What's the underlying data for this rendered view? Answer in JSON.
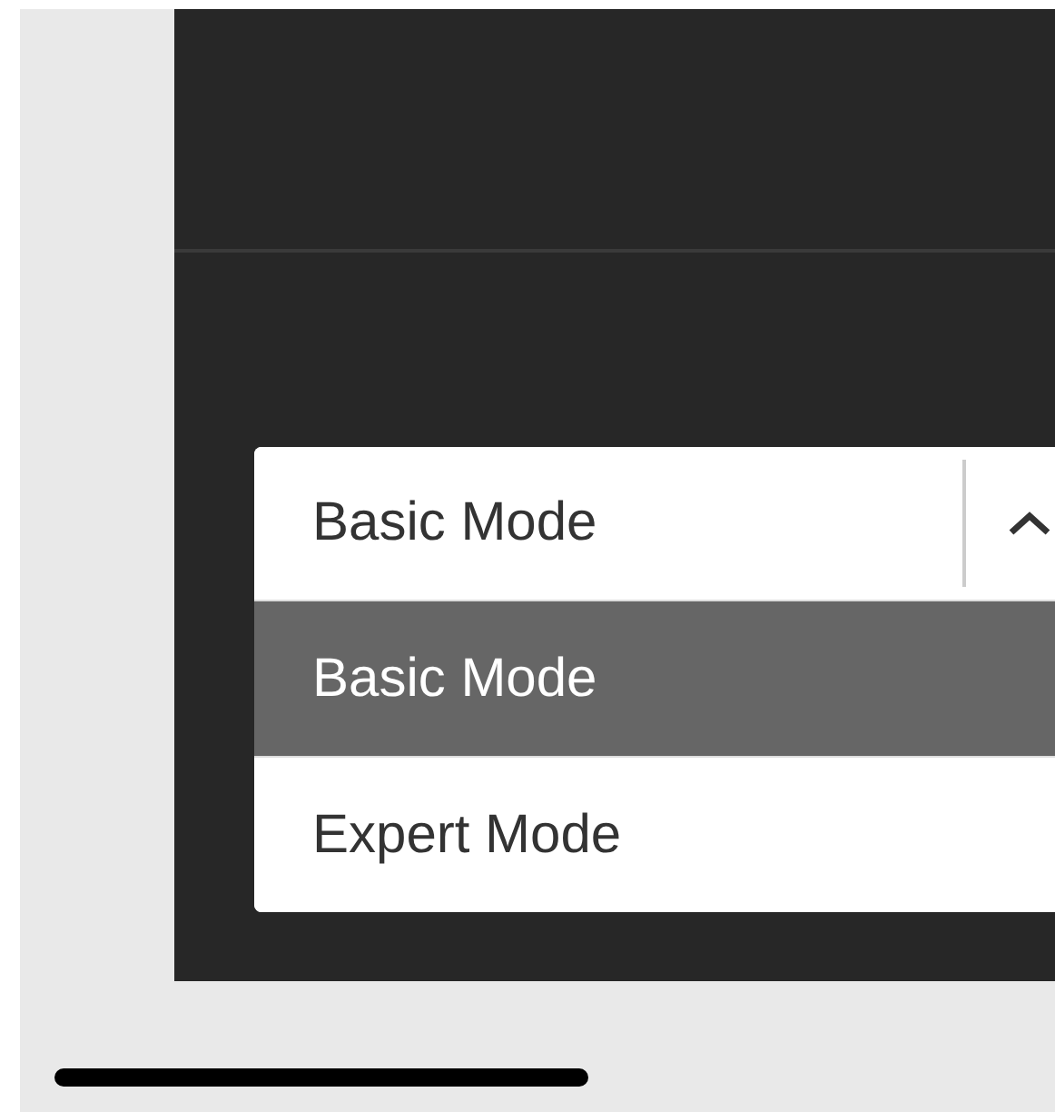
{
  "select": {
    "value": "Basic Mode",
    "expanded": true
  },
  "options": [
    {
      "label": "Basic Mode",
      "selected": true
    },
    {
      "label": "Expert Mode",
      "selected": false
    }
  ]
}
